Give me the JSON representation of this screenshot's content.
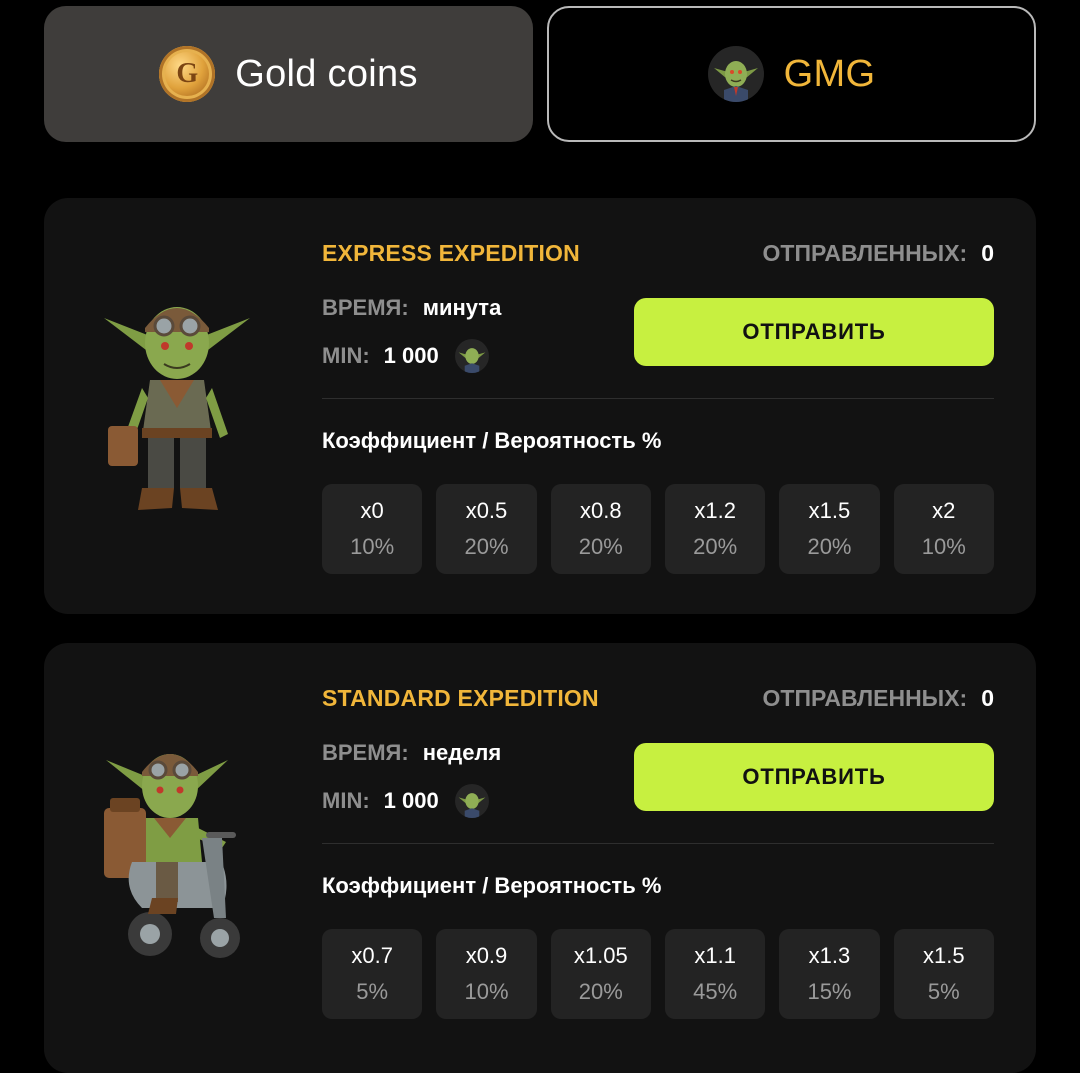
{
  "tabs": {
    "gold": {
      "label": "Gold coins",
      "icon": "gold-coin-icon",
      "icon_letter": "G",
      "state": "selected"
    },
    "gmg": {
      "label": "GMG",
      "icon": "goblin-token-icon",
      "color": "#f1b63a"
    }
  },
  "colors": {
    "accent_gold": "#f1b63a",
    "send_button": "#c7f040",
    "card_bg": "#121212"
  },
  "expeditions": [
    {
      "title": "EXPRESS EXPEDITION",
      "sent_label": "ОТПРАВЛЕННЫХ:",
      "sent_count": "0",
      "time_label": "ВРЕМЯ:",
      "time_value": "минута",
      "min_label": "MIN:",
      "min_value": "1 000",
      "send_label": "ОТПРАВИТЬ",
      "coef_title": "Коэффициент / Вероятность %",
      "odds": [
        {
          "mult": "x0",
          "prob": "10%"
        },
        {
          "mult": "x0.5",
          "prob": "20%"
        },
        {
          "mult": "x0.8",
          "prob": "20%"
        },
        {
          "mult": "x1.2",
          "prob": "20%"
        },
        {
          "mult": "x1.5",
          "prob": "20%"
        },
        {
          "mult": "x2",
          "prob": "10%"
        }
      ]
    },
    {
      "title": "STANDARD EXPEDITION",
      "sent_label": "ОТПРАВЛЕННЫХ:",
      "sent_count": "0",
      "time_label": "ВРЕМЯ:",
      "time_value": "неделя",
      "min_label": "MIN:",
      "min_value": "1 000",
      "send_label": "ОТПРАВИТЬ",
      "coef_title": "Коэффициент / Вероятность %",
      "odds": [
        {
          "mult": "x0.7",
          "prob": "5%"
        },
        {
          "mult": "x0.9",
          "prob": "10%"
        },
        {
          "mult": "x1.05",
          "prob": "20%"
        },
        {
          "mult": "x1.1",
          "prob": "45%"
        },
        {
          "mult": "x1.3",
          "prob": "15%"
        },
        {
          "mult": "x1.5",
          "prob": "5%"
        }
      ]
    }
  ]
}
